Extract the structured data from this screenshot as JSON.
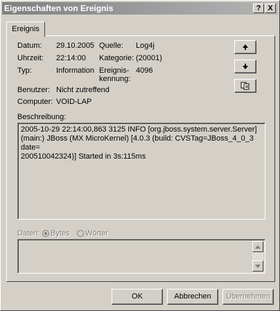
{
  "window": {
    "title": "Eigenschaften von Ereignis",
    "help_btn": "?",
    "close_btn": "X"
  },
  "tab": {
    "label": "Ereignis"
  },
  "fields": {
    "datum_label": "Datum:",
    "datum_value": "29.10.2005",
    "uhrzeit_label": "Uhrzeit:",
    "uhrzeit_value": "22:14:00",
    "typ_label": "Typ:",
    "typ_value": "Information",
    "quelle_label": "Quelle:",
    "quelle_value": "Log4j",
    "kategorie_label": "Kategorie:",
    "kategorie_value": "(20001)",
    "kennung_label_1": "Ereignis-",
    "kennung_label_2": "kennung:",
    "kennung_value": "4096",
    "benutzer_label": "Benutzer:",
    "benutzer_value": "Nicht zutreffend",
    "computer_label": "Computer:",
    "computer_value": "VOID-LAP"
  },
  "description": {
    "label": "Beschreibung:",
    "lines": [
      "2005-10-29 22:14:00,863 3125  INFO  [org.jboss.system.server.Server]",
      "(main:) JBoss (MX MicroKernel) [4.0.3 (build: CVSTag=JBoss_4_0_3 date=",
      "200510042324)] Started in 3s:115ms"
    ]
  },
  "data_section": {
    "label": "Daten:",
    "opt_bytes": "Bytes",
    "opt_words": "Wörter",
    "selected": "Bytes"
  },
  "buttons": {
    "ok": "OK",
    "cancel": "Abbrechen",
    "apply": "Übernehmen"
  }
}
